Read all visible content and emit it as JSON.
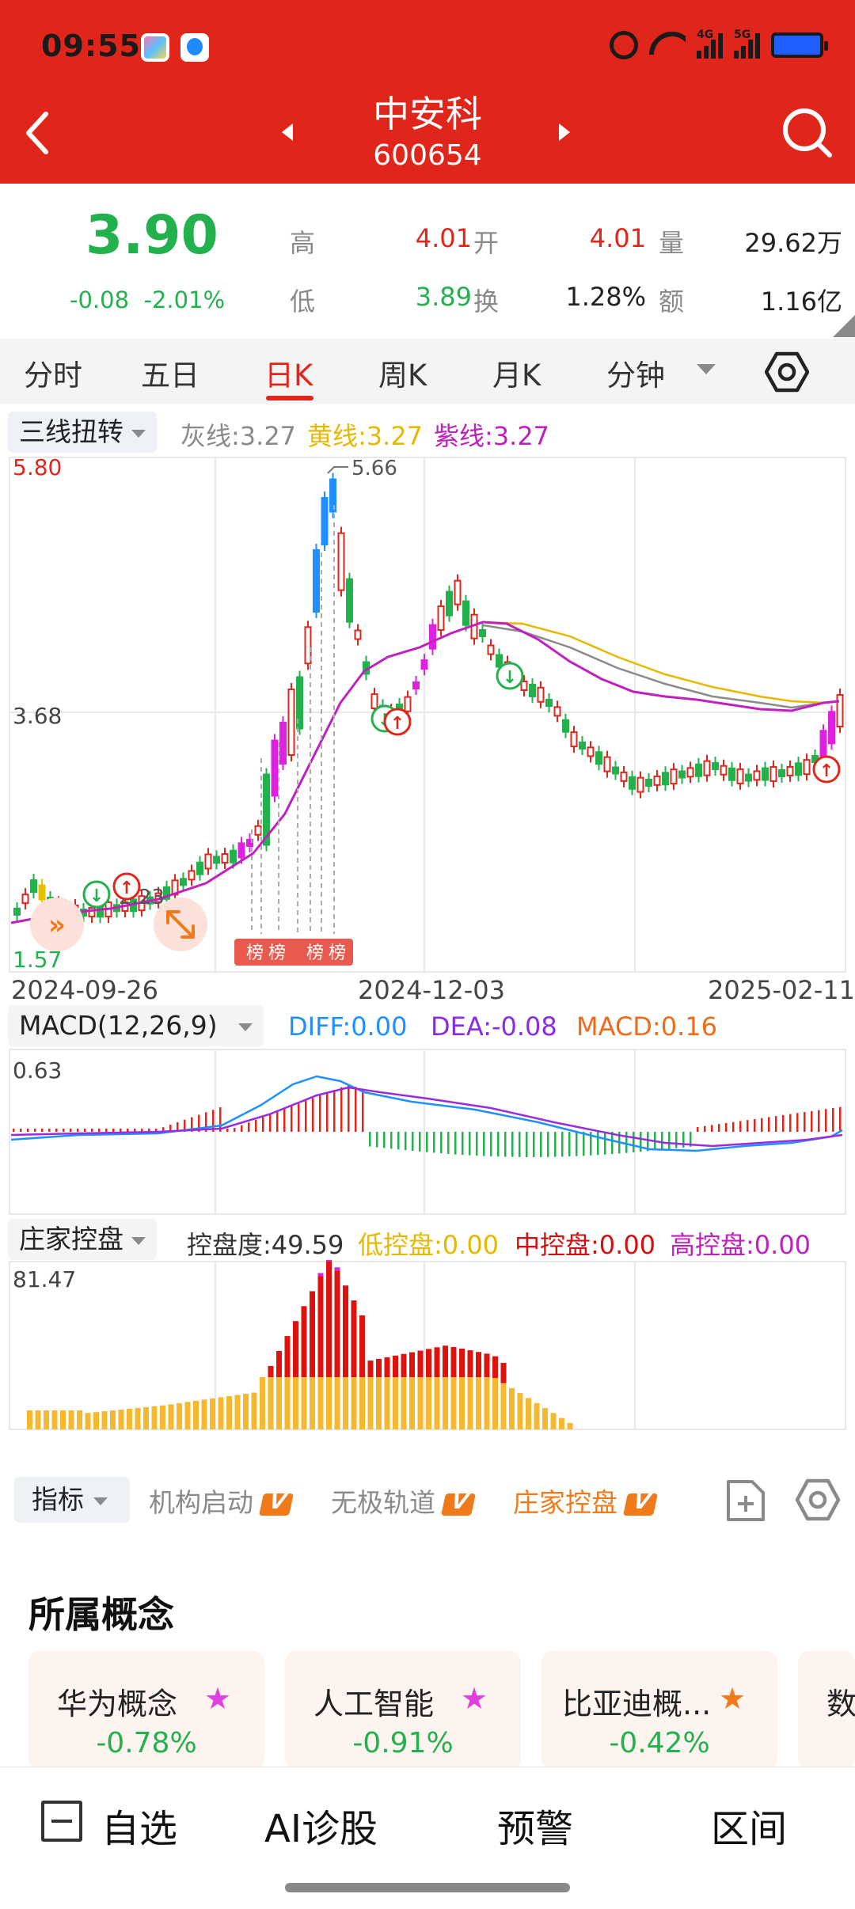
{
  "status_bar": {
    "time": "09:55",
    "net1": "4G",
    "net2": "5G"
  },
  "header": {
    "name": "中安科",
    "code": "600654"
  },
  "quote": {
    "price": "3.90",
    "change": "-0.08",
    "change_pct": "-2.01%",
    "labels": {
      "high": "高",
      "open": "开",
      "volume": "量",
      "low": "低",
      "turnover": "换",
      "amount": "额"
    },
    "values": {
      "high": "4.01",
      "open": "4.01",
      "volume": "29.62万",
      "low": "3.89",
      "turnover": "1.28%",
      "amount": "1.16亿"
    }
  },
  "tabs": [
    {
      "label": "分时"
    },
    {
      "label": "五日"
    },
    {
      "label": "日K"
    },
    {
      "label": "周K"
    },
    {
      "label": "月K"
    },
    {
      "label": "分钟"
    }
  ],
  "main_indicator": {
    "selector": "三线扭转",
    "gray": "灰线:3.27",
    "yellow": "黄线:3.27",
    "purple": "紫线:3.27"
  },
  "kline": {
    "y_top": "5.80",
    "y_mid": "3.68",
    "y_bottom": "1.57",
    "peak_label": "5.66",
    "low_label": "2.23",
    "dates": [
      "2024-09-26",
      "2024-12-03",
      "2025-02-11"
    ],
    "badges": [
      "榜",
      "榜",
      "榜",
      "榜"
    ]
  },
  "macd": {
    "selector": "MACD(12,26,9)",
    "diff": "DIFF:0.00",
    "dea": "DEA:-0.08",
    "macd": "MACD:0.16",
    "y_top": "0.63"
  },
  "zjkp": {
    "selector": "庄家控盘",
    "kpd": "控盘度:49.59",
    "low": "低控盘:0.00",
    "mid": "中控盘:0.00",
    "high": "高控盘:0.00",
    "y_top": "81.47"
  },
  "indicator_bar": {
    "button": "指标",
    "options": [
      "机构启动",
      "无极轨道",
      "庄家控盘"
    ]
  },
  "concepts": {
    "title": "所属概念",
    "items": [
      {
        "name": "华为概念",
        "pct": "-0.78%"
      },
      {
        "name": "人工智能",
        "pct": "-0.91%"
      },
      {
        "name": "比亚迪概...",
        "pct": "-0.42%"
      },
      {
        "name": "数"
      }
    ]
  },
  "bottom_nav": [
    "自选",
    "AI诊股",
    "预警",
    "区间"
  ],
  "colors": {
    "red": "#e0251b",
    "green": "#22b14c",
    "orange": "#f07a1a",
    "purple": "#c020c0",
    "blue": "#1e90ff"
  }
}
